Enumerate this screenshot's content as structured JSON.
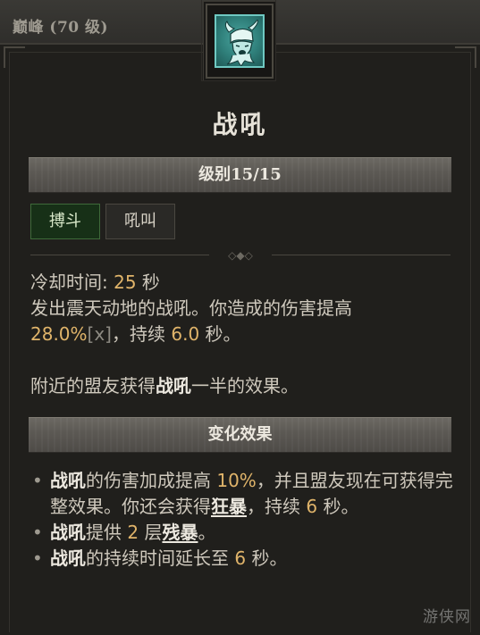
{
  "header": {
    "tier_label": "巅峰 (70 级)"
  },
  "skill": {
    "title": "战吼",
    "icon": "warrior-helmet-icon",
    "rank_label": "级别15/15"
  },
  "tags": [
    "搏斗",
    "吼叫"
  ],
  "description": {
    "cooldown_label": "冷却时间: ",
    "cooldown_value": "25",
    "cooldown_unit": " 秒",
    "line1": "发出震天动地的战吼。你造成的伤害提高",
    "bonus_value": "28.0%",
    "bonus_tag": "[x]",
    "duration_prefix": "，持续 ",
    "duration_value": "6.0",
    "duration_unit": " 秒。",
    "ally_prefix": "附近的盟友获得",
    "ally_skill": "战吼",
    "ally_suffix": "一半的效果。"
  },
  "modifiers": {
    "header": "变化效果",
    "b1": {
      "skill": "战吼",
      "t1": "的伤害加成提高 ",
      "v1": "10%",
      "t2": "，并且盟友现在可获得完整效果。你还会获得",
      "keyword": "狂暴",
      "t3": "，持续 ",
      "v2": "6",
      "t4": " 秒。"
    },
    "b2": {
      "skill": "战吼",
      "t1": "提供 ",
      "v1": "2",
      "t2": " 层",
      "keyword": "残暴",
      "t3": "。"
    },
    "b3": {
      "skill": "战吼",
      "t1": "的持续时间延长至 ",
      "v1": "6",
      "t2": " 秒。"
    }
  },
  "watermark": "游侠网",
  "colors": {
    "value": "#e0b46a",
    "tag_combat_bg": "#173017",
    "icon_teal": "#4aa6a0"
  }
}
